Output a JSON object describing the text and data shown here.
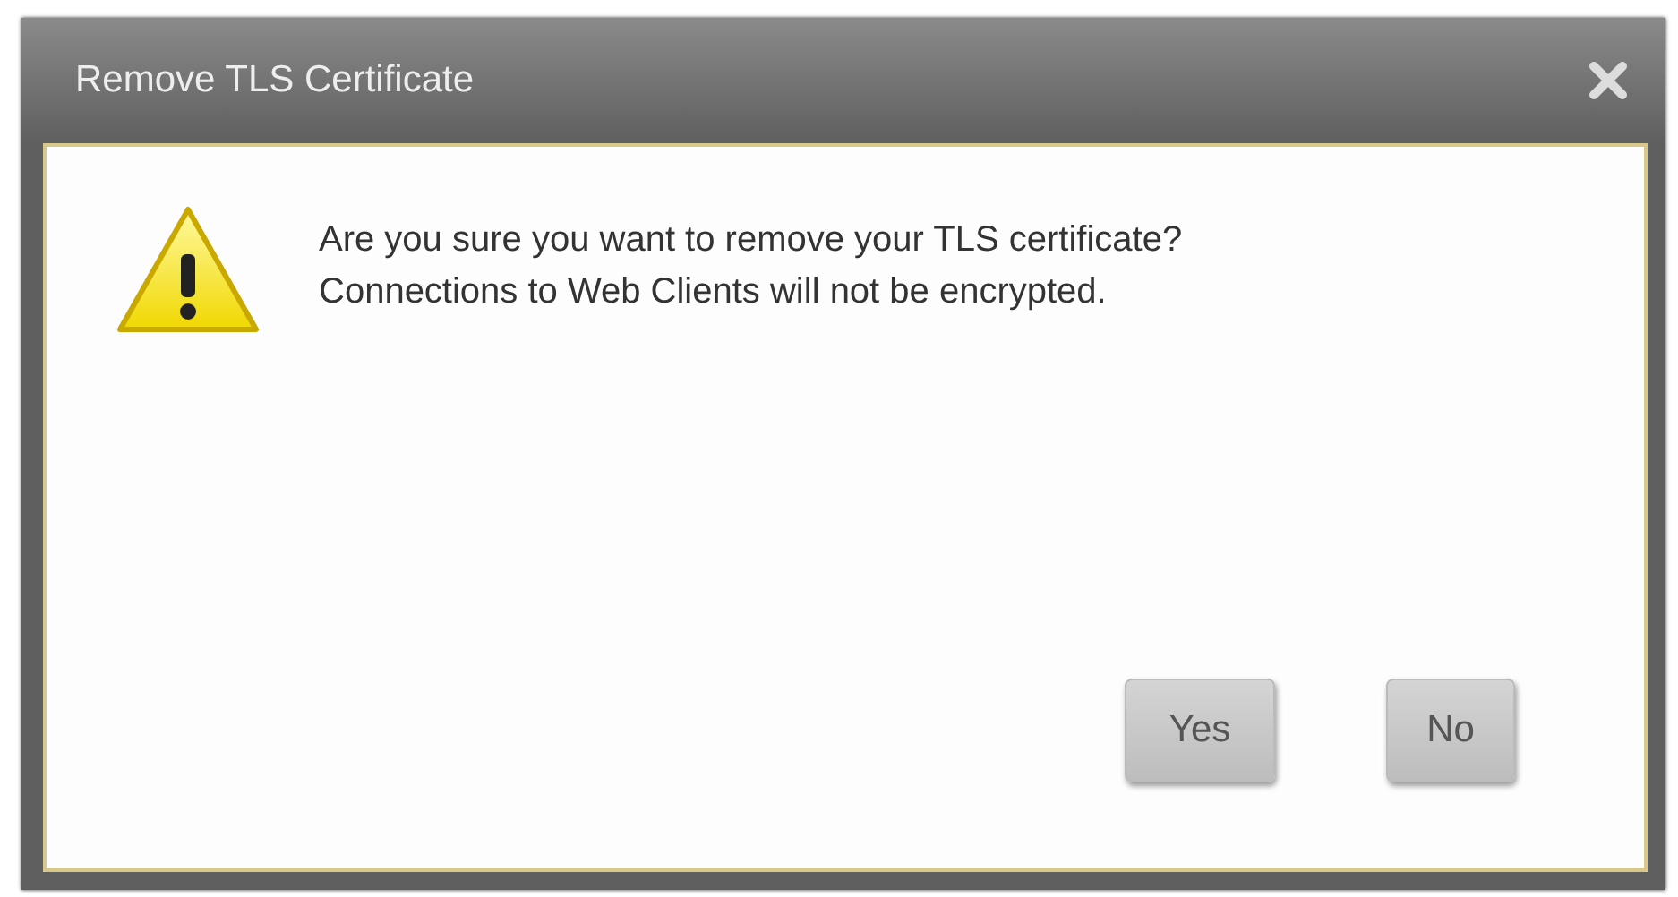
{
  "window": {
    "title": "Remove TLS Certificate"
  },
  "message": [
    "Are you sure you want to remove your TLS certificate?",
    "Connections to Web Clients will not be encrypted."
  ],
  "buttons": [
    "Yes",
    "No"
  ]
}
